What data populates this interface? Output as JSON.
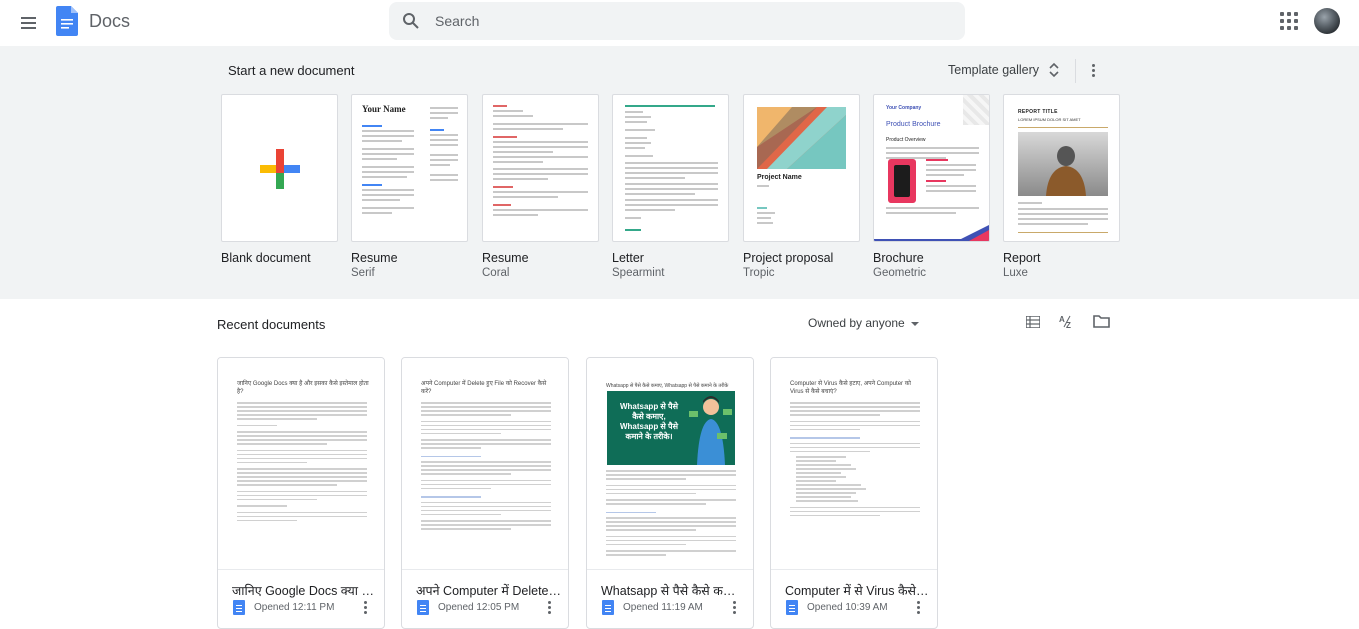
{
  "header": {
    "app_title": "Docs",
    "search_placeholder": "Search"
  },
  "templates": {
    "section_title": "Start a new document",
    "gallery_label": "Template gallery",
    "items": [
      {
        "name": "Blank document",
        "sub": ""
      },
      {
        "name": "Resume",
        "sub": "Serif",
        "thumb_heading": "Your Name"
      },
      {
        "name": "Resume",
        "sub": "Coral"
      },
      {
        "name": "Letter",
        "sub": "Spearmint"
      },
      {
        "name": "Project proposal",
        "sub": "Tropic",
        "thumb_heading": "Project Name"
      },
      {
        "name": "Brochure",
        "sub": "Geometric",
        "thumb_company": "Your Company",
        "thumb_heading": "Product Brochure",
        "thumb_sub": "Product Overview"
      },
      {
        "name": "Report",
        "sub": "Luxe",
        "thumb_heading": "REPORT TITLE",
        "thumb_sub": "LOREM IPSUM DOLOR SIT AMET"
      }
    ]
  },
  "recent": {
    "title": "Recent documents",
    "owner_filter": "Owned by anyone",
    "docs": [
      {
        "title": "जानिए Google Docs क्या है ...",
        "opened": "Opened 12:11 PM",
        "thumb_heading": "जानिए Google Docs क्या है और इसका कैसे इस्तेमाल होता है?"
      },
      {
        "title": "अपने Computer में Delete हु...",
        "opened": "Opened 12:05 PM",
        "thumb_heading": "अपने Computer में Delete हुए File को Recover कैसे करें?"
      },
      {
        "title": "Whatsapp से पैसे कैसे कमाए...",
        "opened": "Opened 11:19 AM",
        "thumb_heading": "Whatsapp से पैसे कैसे कमाए, Whatsapp से पैसे कमाने के तरीके",
        "banner_text": "Whatsapp से पैसे कैसे कमाए, Whatsapp से पैसे कमाने के तरीके।"
      },
      {
        "title": "Computer में से Virus कैसे ह...",
        "opened": "Opened 10:39 AM",
        "thumb_heading": "Computer से Virus कैसे हटाए, अपने Computer को Virus से कैसे बचाएं?"
      }
    ]
  },
  "colors": {
    "google_blue": "#4285f4",
    "google_red": "#ea4335",
    "google_yellow": "#fbbc04",
    "google_green": "#34a853",
    "template_bg": "#f1f3f4"
  }
}
